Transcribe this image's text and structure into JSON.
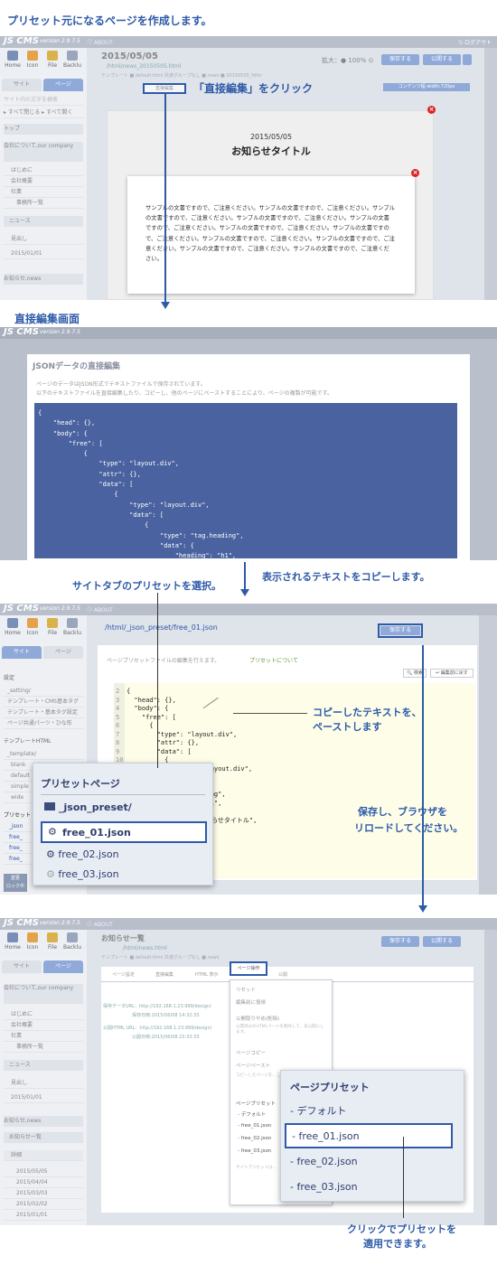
{
  "headings": {
    "create_preset": "プリセット元になるページを作成します。",
    "direct_edit_screen": "直接編集画面"
  },
  "app": {
    "logo": "JS CMS",
    "version": "version 2.9.7.5",
    "about": "ⓘ ABOUT",
    "logout": "⎋ ログアウト",
    "tools": [
      "Home",
      "Icon",
      "File",
      "Backlu"
    ],
    "tab_site": "サイト",
    "tab_page": "ページ",
    "save": "保存する",
    "public": "公開する"
  },
  "s1": {
    "date": "2015/05/05",
    "file": "/html/news_20150505.html",
    "tpl": "テンプレート ■ default.html 共通グループなし ■ news ■ 20150505_fdfor",
    "zoom": "拡大：● 100% ⊙",
    "contents_width": "コンテンツ幅 width:720px",
    "direct_edit_btn": "直接編集",
    "callout": "「直接編集」をクリック",
    "preview_date": "2015/05/05",
    "preview_title": "お知らせタイトル",
    "preview_body": "サンプルの文書ですので、ご注意ください。サンプルの文書ですので、ご注意ください。サンプルの文書ですので、ご注意ください。サンプルの文書ですので、ご注意ください。サンプルの文書ですので、ご注意ください。サンプルの文書ですので、ご注意ください。サンプルの文書ですので、ご注意ください。サンプルの文書ですので、ご注意ください。サンプルの文書ですので、ご注意ください。サンプルの文書ですので、ご注意ください。サンプルの文書ですので、ご注意ください。",
    "sidebar": [
      "サイト内の文字を検索",
      "▸ すべて閉じる ▸ すべて開く",
      "トップ",
      "会社について,our company",
      "はじめに",
      "会社概要",
      "社業",
      "事務所一覧",
      "ニュース",
      "見出し",
      "2015/01/01",
      "お知らせ,news"
    ]
  },
  "s2": {
    "title": "JSONデータの直接編集",
    "desc1": "ページのデータはJSON形式でテキストファイルで保存されています。",
    "desc2": "以下のテキストファイルを直接編集したり、コピーし、他のページにペーストすることにより、ページの複製が可能です。",
    "json": "{\n    \"head\": {},\n    \"body\": {\n        \"free\": [\n            {\n                \"type\": \"layout.div\",\n                \"attr\": {},\n                \"data\": [\n                    {\n                        \"type\": \"layout.div\",\n                        \"data\": [\n                            {\n                                \"type\": \"tag.heading\",\n                                \"data\": {\n                                    \"heading\": \"h1\",\n                                    \"main\": {\n                                        \"text\": \"お知らせタイトル\",\n                                        \"link\": null"
  },
  "mid": {
    "select_preset": "サイトタブのプリセットを選択。",
    "copy_text": "表示されるテキストをコピーします。"
  },
  "s3": {
    "path": "/html/_json_preset/free_01.json",
    "desc": "ページプリセットファイルの編集を行えます。",
    "link": "プリセットについて",
    "search": "🔍 検索",
    "revert": "↩ 編集前に戻す",
    "paste_callout_1": "コピーしたテキストを、",
    "paste_callout_2": "ペーストします",
    "save_callout_1": "保存し、ブラウザを",
    "save_callout_2": "リロードしてください。",
    "code": "{\n  \"head\": {},\n  \"body\": {\n    \"free\": [\n      {\n        \"type\": \"layout.div\",\n        \"attr\": {},\n        \"data\": [\n          {\n            \"type\": \"layout.div\",\n\n\n            \"tag.heading\",\n            ading\": \"h1\",\n            n\": {\n            ext\": \"お知らせタイトル\",\n            ink\": null\n\n            nt\": {\n            ext\": \"\",\n            ink\": null",
    "lines": [
      "2",
      "3",
      "4",
      "5",
      "6",
      "7",
      "8",
      "9",
      "10",
      "11",
      "12",
      "13"
    ],
    "sidebar": [
      "設定",
      "_setting/",
      "テンプレート・CMS基本タグ",
      "テンプレート・基本タグ設定",
      "ページ共通パーツ・ひな形",
      "テンプレートHTML",
      "_template/",
      "blank",
      "default",
      "simple",
      "wide",
      "プリセット",
      "_json",
      "free_",
      "free_",
      "free_",
      "変更",
      "ロック中"
    ],
    "popup": {
      "title": "プリセットページ",
      "folder": "_json_preset/",
      "items": [
        "free_01.json",
        "free_02.json",
        "free_03.json"
      ]
    }
  },
  "s4": {
    "title": "お知らせ一覧",
    "file": "/html/news.html",
    "tpl": "テンプレート ■ default.html 共通グループなし ■ news",
    "tabs": [
      "ページ設定",
      "直接編集",
      "HTML 表示",
      "ページ操作",
      "公開"
    ],
    "menu": [
      "リセット",
      "編集前に復帰",
      "公開取りやめ(削除)",
      "公開済みのHTMLページを削除して、未公開にします。",
      "ページコピー",
      "ページペースト",
      "コピーしたページを、この場所に貼り付けます。",
      "ページプリセット",
      "- デフォルト",
      "- free_01.json",
      "- free_02.json",
      "- free_03.json",
      "サイトプリセットは…"
    ],
    "meta": [
      "保存データURL：http://192.168.1.23:999/design/",
      "保存日時:2015/06/08 14:32:33",
      "公開HTML URL：http://192.168.1.23:999/design/",
      "公開日時:2015/06/08 23:33:33"
    ],
    "popup": {
      "title": "ページプリセット",
      "items": [
        "- デフォルト",
        "- free_01.json",
        "- free_02.json",
        "- free_03.json"
      ]
    },
    "callout_1": "クリックでプリセットを",
    "callout_2": "適用できます。",
    "sidebar": [
      "会社について,our company",
      "はじめに",
      "会社概要",
      "社業",
      "事務所一覧",
      "ニュース",
      "見出し",
      "2015/01/01",
      "お知らせ,news",
      "お知らせ一覧",
      "詳細",
      "2015/05/05",
      "2015/04/04",
      "2015/03/03",
      "2015/02/02",
      "2015/01/01"
    ]
  },
  "colors": {
    "accent": "#2e5aa8",
    "json_bg": "#4a63a0",
    "editor_bg": "#fdfde8"
  }
}
